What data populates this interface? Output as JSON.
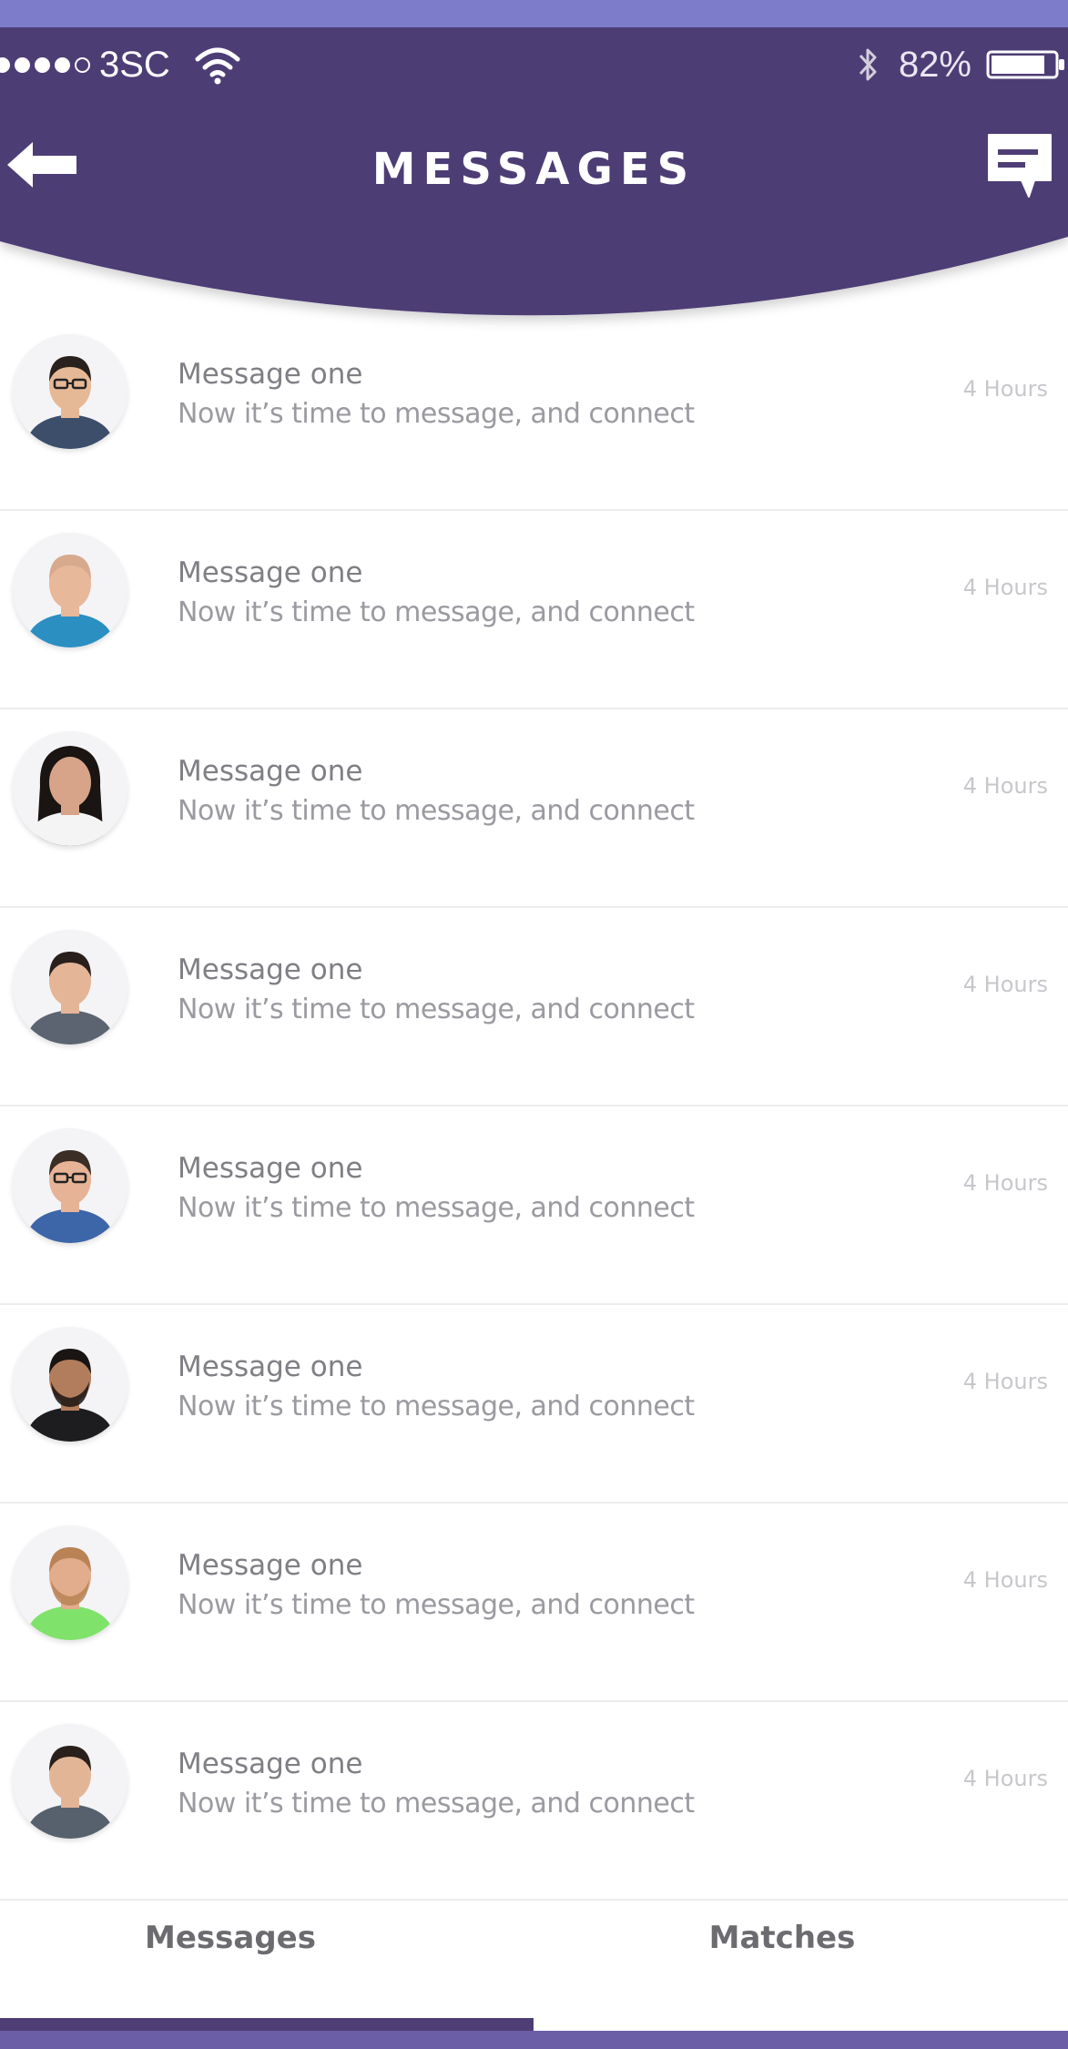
{
  "colors": {
    "header_purple": "#4e3e75",
    "top_strip": "#7d7ccb",
    "tab_indicator": "#4e3e75"
  },
  "status_bar": {
    "carrier": "3SC",
    "battery_percent": "82%",
    "icons": [
      "signal-dots",
      "wifi-icon",
      "bluetooth-icon",
      "battery-icon"
    ]
  },
  "header": {
    "title": "MESSAGES",
    "back_icon": "arrow-left-icon",
    "compose_icon": "chat-bubble-icon"
  },
  "messages": [
    {
      "title": "Message one",
      "preview": "Now it’s time to message, and connect",
      "time": "4 Hours",
      "avatar": "man-glasses-dark-shirt"
    },
    {
      "title": "Message one",
      "preview": "Now it’s time to message, and connect",
      "time": "4 Hours",
      "avatar": "bald-man-blue-shirt"
    },
    {
      "title": "Message one",
      "preview": "Now it’s time to message, and connect",
      "time": "4 Hours",
      "avatar": "woman-long-dark-hair"
    },
    {
      "title": "Message one",
      "preview": "Now it’s time to message, and connect",
      "time": "4 Hours",
      "avatar": "young-man-grey-shirt"
    },
    {
      "title": "Message one",
      "preview": "Now it’s time to message, and connect",
      "time": "4 Hours",
      "avatar": "man-glasses-blue-shirt"
    },
    {
      "title": "Message one",
      "preview": "Now it’s time to message, and connect",
      "time": "4 Hours",
      "avatar": "bearded-man-black-shirt"
    },
    {
      "title": "Message one",
      "preview": "Now it’s time to message, and connect",
      "time": "4 Hours",
      "avatar": "bearded-man-green-shirt"
    },
    {
      "title": "Message one",
      "preview": "Now it’s time to message, and connect",
      "time": "4 Hours",
      "avatar": "young-man-grey-shirt-2"
    }
  ],
  "tabs": [
    {
      "label": "Messages",
      "active": true
    },
    {
      "label": "Matches",
      "active": false
    }
  ]
}
